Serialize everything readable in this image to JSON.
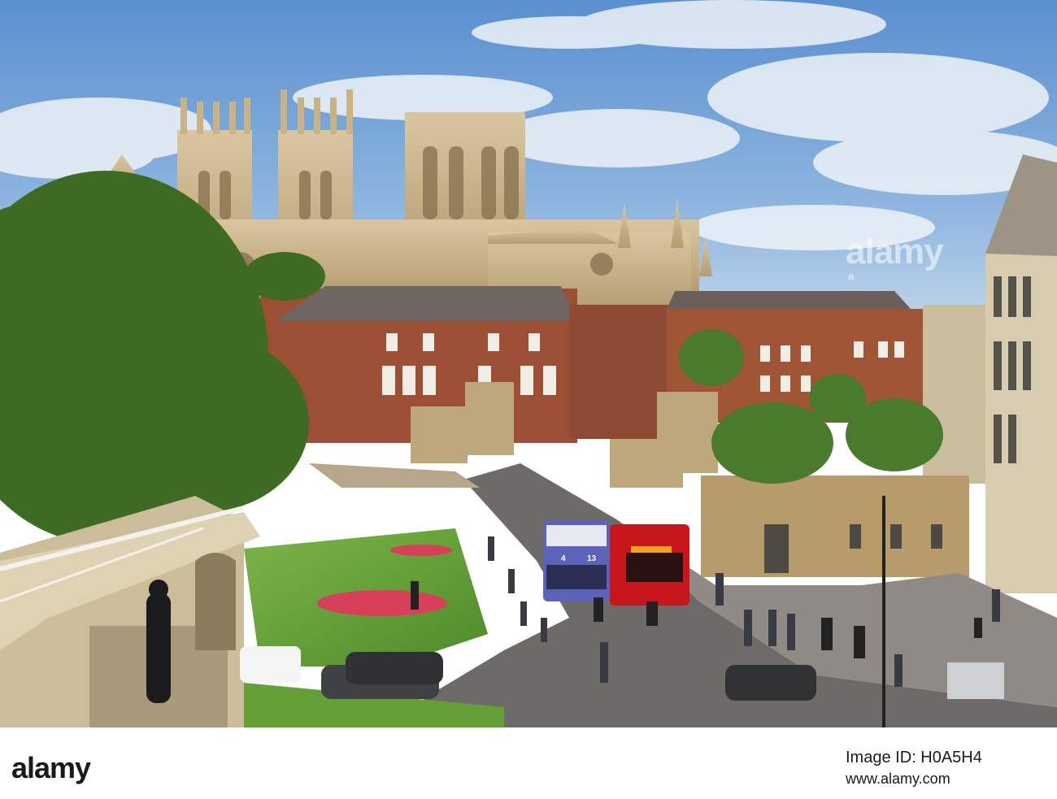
{
  "watermark": {
    "main": "alamy",
    "small": "a"
  },
  "footer": {
    "logo": "alamy",
    "image_id": "Image ID: H0A5H4",
    "url": "www.alamy.com"
  },
  "scene": {
    "bus_left_route": "4",
    "bus_left_route2": "13",
    "colors": {
      "sky": "#6f9fd6",
      "stone": "#cdb88e",
      "brick": "#9a4a32",
      "grass": "#6aa53a",
      "tree": "#3e6e24",
      "road": "#6c6a67",
      "bus_red": "#c8171c",
      "bus_blue": "#5d63b8"
    }
  }
}
